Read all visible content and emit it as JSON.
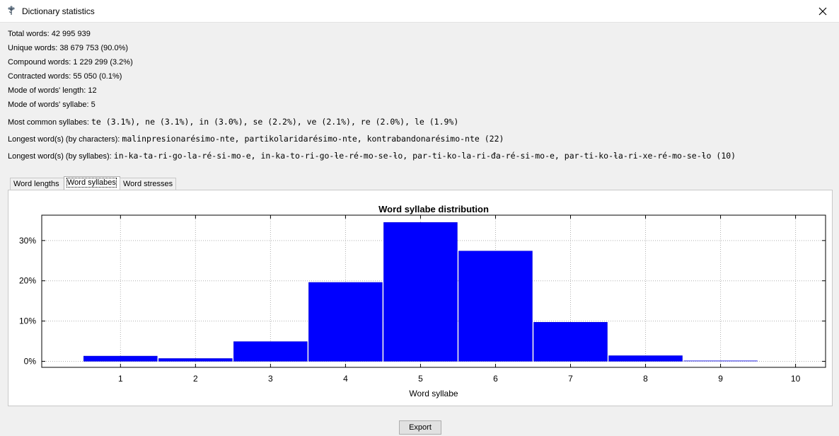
{
  "window": {
    "title": "Dictionary statistics",
    "icon": "flower-app-icon",
    "close_icon": "close-icon"
  },
  "stats": [
    {
      "label": "Total words:",
      "value": "42 995 939"
    },
    {
      "label": "Unique words:",
      "value": "38 679 753 (90.0%)"
    },
    {
      "label": "Compound words:",
      "value": "1 229 299 (3.2%)"
    },
    {
      "label": "Contracted words:",
      "value": "55 050 (0.1%)"
    },
    {
      "label": "Mode of words' length:",
      "value": "12"
    },
    {
      "label": "Mode of words' syllabe:",
      "value": "5"
    },
    {
      "label": "Most common syllabes:",
      "value": "te (3.1%), ne (3.1%), in (3.0%), se (2.2%), ve (2.1%), re (2.0%), le (1.9%)"
    },
    {
      "label": "Longest word(s) (by characters):",
      "value": "malinpresionarésimo-nte, partikolaridarésimo-nte, kontrabandonarésimo-nte (22)"
    },
    {
      "label": "Longest word(s) (by syllabes):",
      "value": "in-ka-ta-ri-go-la-ré-si-mo-e, in-ka-to-ri-go-ƚe-ré-mo-se-ƚo, par-ti-ko-la-ri-đa-ré-si-mo-e, par-ti-ko-ƚa-ri-xe-ré-mo-se-ƚo (10)"
    }
  ],
  "tabs": [
    {
      "label": "Word lengths",
      "active": false
    },
    {
      "label": "Word syllabes",
      "active": true
    },
    {
      "label": "Word stresses",
      "active": false
    }
  ],
  "chart_data": {
    "type": "bar",
    "title": "Word syllabe distribution",
    "xlabel": "Word syllabe",
    "ylabel": "",
    "categories": [
      "1",
      "2",
      "3",
      "4",
      "5",
      "6",
      "7",
      "8",
      "9",
      "10"
    ],
    "values": [
      1.3,
      0.7,
      4.9,
      19.6,
      34.5,
      27.4,
      9.7,
      1.4,
      0.2,
      0.0
    ],
    "ylim": [
      -1.5,
      36.3
    ],
    "yticks": [
      0,
      10,
      20,
      30
    ],
    "ytick_labels": [
      "0%",
      "10%",
      "20%",
      "30%"
    ],
    "grid": true,
    "bar_color": "#0000ff"
  },
  "export_label": "Export"
}
